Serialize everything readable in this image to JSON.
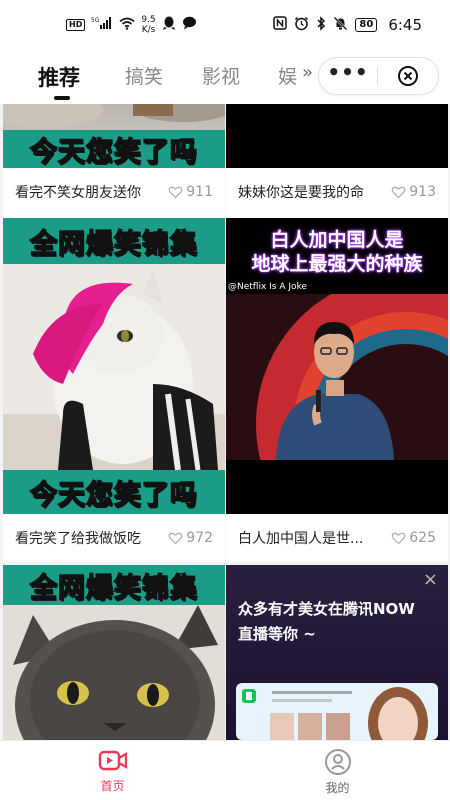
{
  "status_bar": {
    "hd_chip": "HD",
    "network": "5G",
    "speed_value": "9.5",
    "speed_unit": "K/s",
    "battery": "80",
    "time": "6:45"
  },
  "tabs": {
    "items": [
      "推荐",
      "搞笑",
      "影视",
      "娱"
    ],
    "active_index": 0,
    "more_glyph": "»"
  },
  "capsule": {
    "more_glyph": "•••"
  },
  "feed": {
    "cards": [
      {
        "banner": "今天您笑了吗",
        "caption": "看完不笑女朋友送你",
        "likes": "911"
      },
      {
        "caption": "妹妹你这是要我的命",
        "likes": "913"
      },
      {
        "banner_top": "全网爆笑锦集",
        "banner_bottom": "今天您笑了吗",
        "caption": "看完笑了给我做饭吃",
        "likes": "972"
      },
      {
        "headline_line1": "白人加中国人是",
        "headline_line2": "地球上最强大的种族",
        "watermark": "@Netflix Is A Joke",
        "caption": "白人加中国人是世...",
        "likes": "625"
      },
      {
        "banner_top": "全网爆笑锦集"
      },
      {
        "ad_line1": "众多有才美女在腾讯NOW",
        "ad_line2": "直播等你 ~",
        "ad_close": "×"
      }
    ]
  },
  "bottom_nav": {
    "items": [
      {
        "label": "首页",
        "icon": "video-icon",
        "active": true
      },
      {
        "label": "我的",
        "icon": "profile-icon",
        "active": false
      }
    ],
    "active_color": "#e8385a"
  }
}
